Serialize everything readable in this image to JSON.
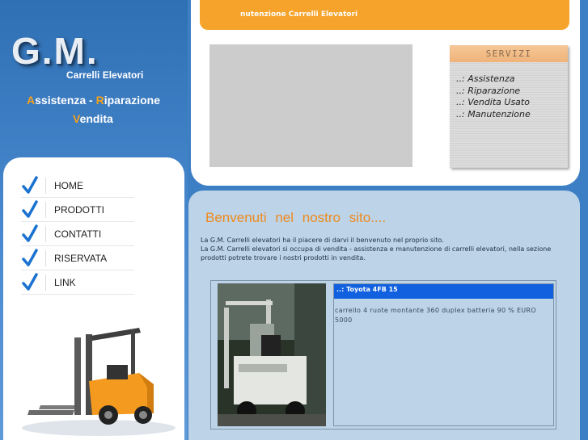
{
  "brand": {
    "logo": "G.M.",
    "tagline": "Carrelli Elevatori",
    "slogan_line1": [
      {
        "text": "A",
        "highlight": true
      },
      {
        "text": "ssistenza - ",
        "highlight": false
      },
      {
        "text": "R",
        "highlight": true
      },
      {
        "text": "iparazione",
        "highlight": false
      }
    ],
    "slogan_line2": [
      {
        "text": "V",
        "highlight": true
      },
      {
        "text": "endita",
        "highlight": false
      }
    ]
  },
  "nav": {
    "items": [
      {
        "label": "HOME"
      },
      {
        "label": "PRODOTTI"
      },
      {
        "label": "CONTATTI"
      },
      {
        "label": "RISERVATA"
      },
      {
        "label": "LINK"
      }
    ]
  },
  "header": {
    "marquee": "nutenzione Carrelli Elevatori"
  },
  "servizi": {
    "title": "SERVIZI",
    "items": [
      {
        "label": "..: Assistenza"
      },
      {
        "label": "..: Riparazione"
      },
      {
        "label": "..: Vendita Usato"
      },
      {
        "label": "..: Manutenzione"
      }
    ]
  },
  "welcome": {
    "title": "Benvenuti nel nostro sito....",
    "line1": "La G.M. Carrelli elevatori ha il piacere di darvi il benvenuto nel proprio sito.",
    "line2": "La G.M. Carrelli elevatori si occupa di vendita - assistenza e manutenzione di carrelli elevatori, nella sezione prodotti potrete trovare i nostri prodotti in vendita."
  },
  "product": {
    "title": "..: Toyota 4FB 15",
    "description": "carrello 4 ruote montante 360 duplex batteria 90 % EURO 5000"
  },
  "colors": {
    "accent_orange": "#f5a32a",
    "background_blue": "#3d7fc4",
    "product_title_blue": "#1060e0"
  }
}
